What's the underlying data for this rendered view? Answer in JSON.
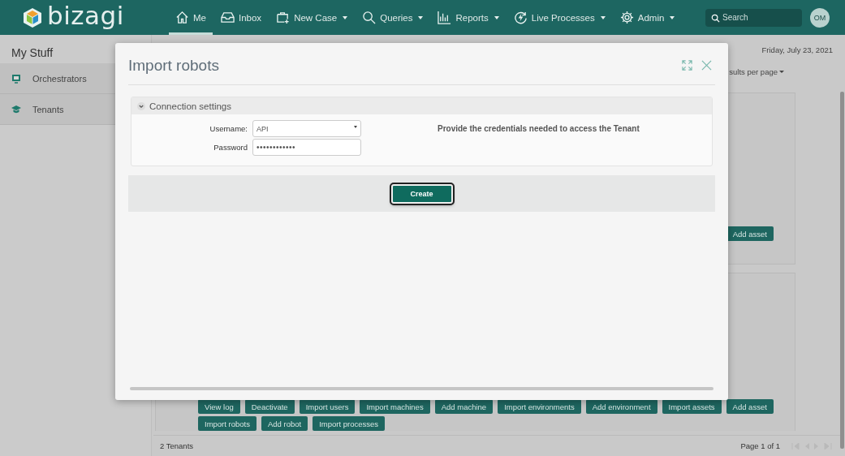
{
  "header": {
    "logo": "bizagi",
    "nav": [
      {
        "label": "Me",
        "selected": true,
        "dropdown": false
      },
      {
        "label": "Inbox",
        "selected": false,
        "dropdown": false
      },
      {
        "label": "New Case",
        "selected": false,
        "dropdown": true
      },
      {
        "label": "Queries",
        "selected": false,
        "dropdown": true
      },
      {
        "label": "Reports",
        "selected": false,
        "dropdown": true
      },
      {
        "label": "Live Processes",
        "selected": false,
        "dropdown": true
      },
      {
        "label": "Admin",
        "selected": false,
        "dropdown": true
      }
    ],
    "search": {
      "placeholder": "Search"
    },
    "avatar": "OM"
  },
  "sidebar": {
    "title": "My Stuff",
    "items": [
      {
        "label": "Orchestrators"
      },
      {
        "label": "Tenants"
      }
    ]
  },
  "content": {
    "date": "Friday, July 23, 2021",
    "results_per_page": "sults per page",
    "card_1_buttons": [
      "Add asset"
    ],
    "card_2_buttons": [
      [
        "View log",
        "Deactivate",
        "Import users",
        "Import machines",
        "Add machine",
        "Import environments",
        "Add environment",
        "Import assets",
        "Add asset"
      ],
      [
        "Import robots",
        "Add robot",
        "Import processes"
      ]
    ],
    "footer": {
      "count": "2 Tenants",
      "page": "Page 1 of 1"
    }
  },
  "dialog": {
    "title": "Import robots",
    "section": {
      "title": "Connection settings",
      "expanded": true,
      "fields": [
        {
          "label": "Username:",
          "kind": "dropdown",
          "value": "API"
        },
        {
          "label": "Password",
          "kind": "password",
          "value": "••••••••••••"
        }
      ],
      "help": "Provide the credentials needed to access the Tenant"
    },
    "buttons": [
      "Create"
    ]
  }
}
